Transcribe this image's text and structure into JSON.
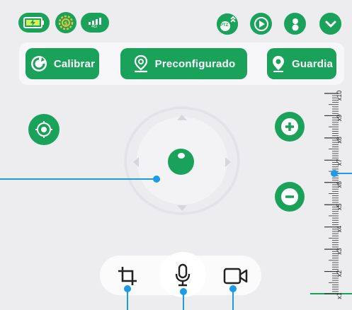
{
  "colors": {
    "accent": "#1aa25a",
    "background": "#ededf0",
    "callout": "#1e9be8"
  },
  "status_bar": {
    "battery_icon": "battery-charging-icon",
    "power_icon": "power-saving-icon",
    "signal_label": "4G",
    "ptz_label": "PTZ"
  },
  "modes": {
    "calibrate": "Calibrar",
    "preset": "Preconfigurado",
    "guard": "Guardia"
  },
  "zoom": {
    "ticks": [
      "x1",
      "x2",
      "x3",
      "x4",
      "x5",
      "x6",
      "x7",
      "x8",
      "x9",
      "x10"
    ]
  },
  "toolbar": {
    "crop_icon": "crop-icon",
    "mic_icon": "microphone-icon",
    "record_icon": "video-camera-icon"
  }
}
